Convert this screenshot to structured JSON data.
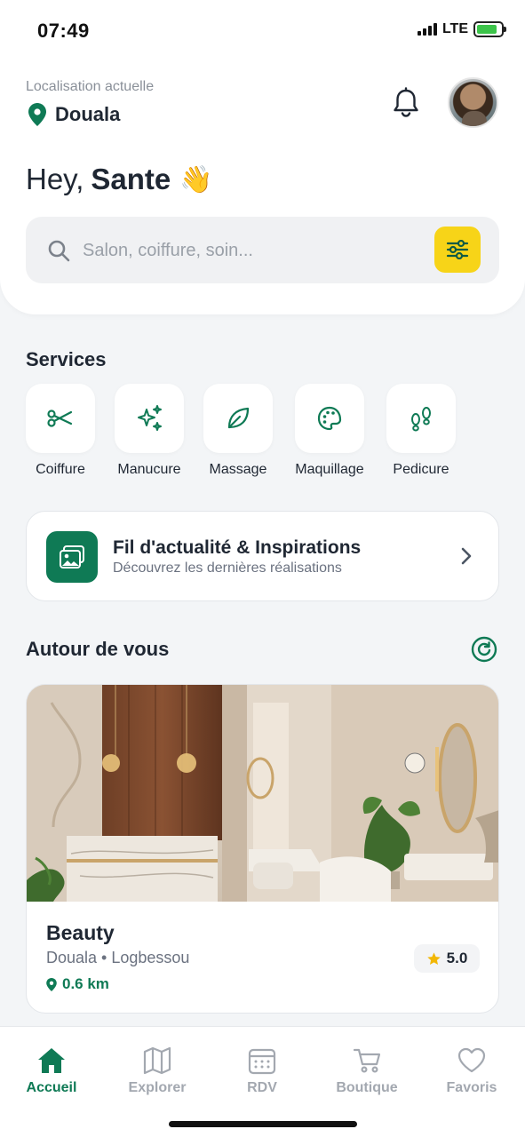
{
  "status_bar": {
    "time": "07:49",
    "network": "LTE",
    "battery_level": 0.85
  },
  "header": {
    "location_label": "Localisation actuelle",
    "city": "Douala",
    "greeting": "Hey,",
    "user_name": "Sante",
    "wave_emoji": "👋",
    "icons": {
      "location": "map-pin-icon",
      "notifications": "bell-icon",
      "avatar": "user-avatar"
    }
  },
  "search": {
    "placeholder": "Salon, coiffure, soin...",
    "filter_icon": "sliders-icon",
    "accent": "#f7d418"
  },
  "services": {
    "title": "Services",
    "items": [
      {
        "label": "Coiffure",
        "icon": "scissors-icon"
      },
      {
        "label": "Manucure",
        "icon": "sparkles-icon"
      },
      {
        "label": "Massage",
        "icon": "leaf-icon"
      },
      {
        "label": "Maquillage",
        "icon": "palette-icon"
      },
      {
        "label": "Pedicure",
        "icon": "footprints-icon"
      }
    ]
  },
  "feed": {
    "title": "Fil d'actualité & Inspirations",
    "subtitle": "Découvrez les dernières réalisations",
    "icon": "gallery-icon"
  },
  "nearby": {
    "title": "Autour de vous",
    "refresh_icon": "refresh-icon",
    "salon": {
      "name": "Beauty",
      "location": "Douala • Logbessou",
      "distance": "0.6 km",
      "rating": "5.0"
    }
  },
  "tabbar": {
    "items": [
      {
        "label": "Accueil",
        "icon": "home-icon",
        "active": true
      },
      {
        "label": "Explorer",
        "icon": "map-icon",
        "active": false
      },
      {
        "label": "RDV",
        "icon": "calendar-icon",
        "active": false
      },
      {
        "label": "Boutique",
        "icon": "cart-icon",
        "active": false
      },
      {
        "label": "Favoris",
        "icon": "heart-icon",
        "active": false
      }
    ]
  },
  "colors": {
    "primary": "#0f7a55",
    "accent": "#f7d418",
    "background": "#f3f5f7",
    "text": "#1f2733",
    "muted": "#a3a8b0"
  }
}
